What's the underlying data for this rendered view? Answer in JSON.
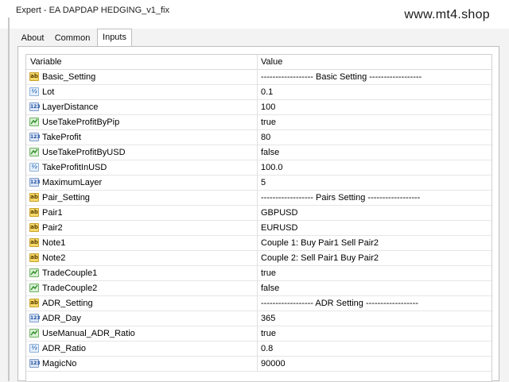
{
  "window": {
    "title": "Expert - EA DAPDAP HEDGING_v1_fix",
    "watermark": "www.mt4.shop"
  },
  "tabs": [
    {
      "label": "About",
      "active": false
    },
    {
      "label": "Common",
      "active": false
    },
    {
      "label": "Inputs",
      "active": true
    }
  ],
  "table": {
    "columns": [
      "Variable",
      "Value"
    ],
    "rows": [
      {
        "icon": "ab",
        "name": "Basic_Setting",
        "value": "------------------ Basic Setting ------------------"
      },
      {
        "icon": "real",
        "name": "Lot",
        "value": "0.1"
      },
      {
        "icon": "num",
        "name": "LayerDistance",
        "value": "100"
      },
      {
        "icon": "bool",
        "name": "UseTakeProfitByPip",
        "value": "true"
      },
      {
        "icon": "num",
        "name": "TakeProfit",
        "value": "80"
      },
      {
        "icon": "bool",
        "name": "UseTakeProfitByUSD",
        "value": "false"
      },
      {
        "icon": "real",
        "name": "TakeProfitInUSD",
        "value": "100.0"
      },
      {
        "icon": "num",
        "name": "MaximumLayer",
        "value": "5"
      },
      {
        "icon": "ab",
        "name": "Pair_Setting",
        "value": "------------------ Pairs Setting ------------------"
      },
      {
        "icon": "ab",
        "name": "Pair1",
        "value": "GBPUSD"
      },
      {
        "icon": "ab",
        "name": "Pair2",
        "value": "EURUSD"
      },
      {
        "icon": "ab",
        "name": "Note1",
        "value": "Couple 1: Buy Pair1 Sell Pair2"
      },
      {
        "icon": "ab",
        "name": "Note2",
        "value": "Couple 2: Sell Pair1 Buy Pair2"
      },
      {
        "icon": "bool",
        "name": "TradeCouple1",
        "value": "true"
      },
      {
        "icon": "bool",
        "name": "TradeCouple2",
        "value": "false"
      },
      {
        "icon": "ab",
        "name": "ADR_Setting",
        "value": "------------------ ADR Setting ------------------"
      },
      {
        "icon": "num",
        "name": "ADR_Day",
        "value": "365"
      },
      {
        "icon": "bool",
        "name": "UseManual_ADR_Ratio",
        "value": "true"
      },
      {
        "icon": "real",
        "name": "ADR_Ratio",
        "value": "0.8"
      },
      {
        "icon": "num",
        "name": "MagicNo",
        "value": "90000"
      }
    ]
  }
}
